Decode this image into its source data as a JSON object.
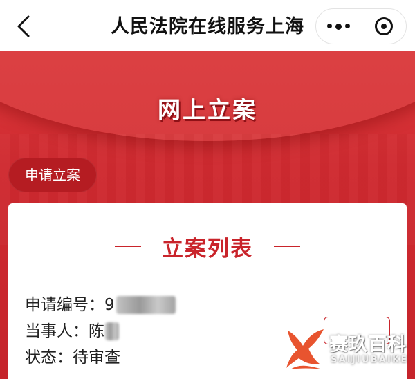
{
  "app": {
    "title": "人民法院在线服务上海"
  },
  "icons": {
    "back": "chevron-left-icon",
    "more": "more-dots-icon",
    "close": "target-close-icon"
  },
  "banner": {
    "title": "网上立案",
    "apply_button": "申请立案"
  },
  "card": {
    "title": "立案列表",
    "case": {
      "number_label": "申请编号：",
      "number_value": "9",
      "party_label": "当事人：",
      "party_value": "陈",
      "status_label": "状态：",
      "status_value": "待审查"
    }
  },
  "watermark": {
    "text": "赛玖百科",
    "sub": "SAIJIUBAIKE"
  },
  "colors": {
    "brand_red": "#c9242b",
    "navbar_bg": "#ffffff"
  }
}
